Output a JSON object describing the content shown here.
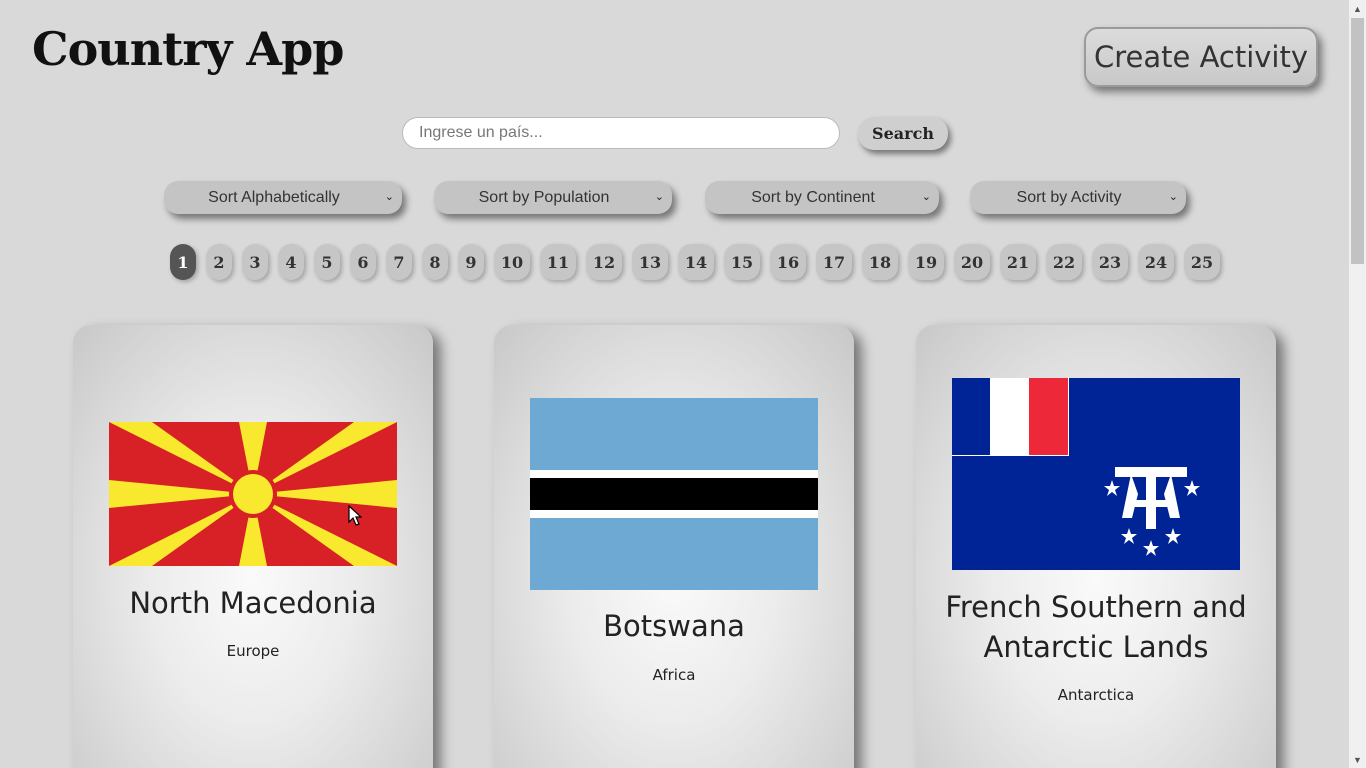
{
  "header": {
    "title": "Country App",
    "create_activity_label": "Create Activity"
  },
  "search": {
    "placeholder": "Ingrese un país...",
    "value": "",
    "button_label": "Search"
  },
  "sorts": [
    {
      "label": "Sort Alphabetically"
    },
    {
      "label": "Sort by Population"
    },
    {
      "label": "Sort by Continent"
    },
    {
      "label": "Sort by Activity"
    }
  ],
  "pagination": {
    "active_page": "1",
    "pages": [
      "1",
      "2",
      "3",
      "4",
      "5",
      "6",
      "7",
      "8",
      "9",
      "10",
      "11",
      "12",
      "13",
      "14",
      "15",
      "16",
      "17",
      "18",
      "19",
      "20",
      "21",
      "22",
      "23",
      "24",
      "25"
    ]
  },
  "cards": [
    {
      "name": "North Macedonia",
      "continent": "Europe",
      "flag_icon": "north-macedonia-flag"
    },
    {
      "name": "Botswana",
      "continent": "Africa",
      "flag_icon": "botswana-flag"
    },
    {
      "name": "French Southern and Antarctic Lands",
      "continent": "Antarctica",
      "flag_icon": "french-southern-antarctic-lands-flag"
    }
  ],
  "colors": {
    "background": "#d9d9d9",
    "active_page": "#555555",
    "macedonia_red": "#d82126",
    "macedonia_yellow": "#f8e92e",
    "botswana_blue": "#6da9d2",
    "taaf_blue": "#002395",
    "taaf_red": "#ed2939"
  }
}
